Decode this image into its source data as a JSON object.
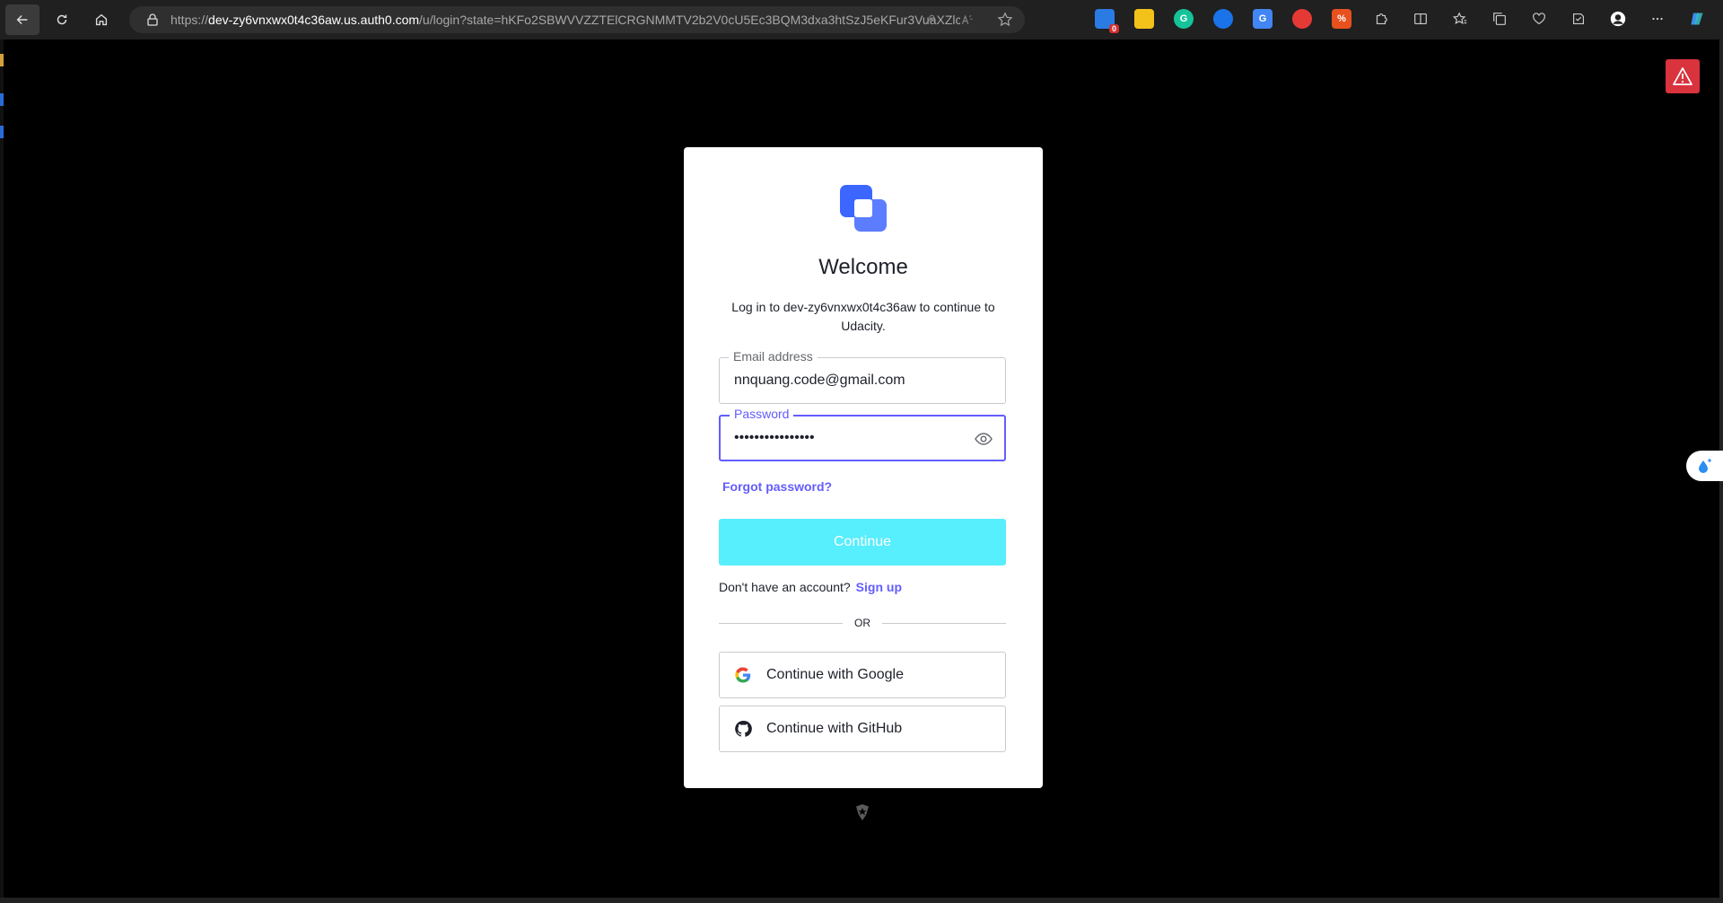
{
  "browser": {
    "url_prefix": "https://",
    "url_host": "dev-zy6vnxwx0t4c36aw.us.auth0.com",
    "url_path": "/u/login?state=hKFo2SBWVVZZTElCRGNMMTV2b2V0cU5Ec3BQM3dxa3htSzJ5eKFur3VuaXZlcnN...",
    "extension_badge": "0",
    "extension_pdf_label": "%"
  },
  "login": {
    "title": "Welcome",
    "subtitle": "Log in to dev-zy6vnxwx0t4c36aw to continue to Udacity.",
    "email_label": "Email address",
    "email_value": "nnquang.code@gmail.com",
    "password_label": "Password",
    "password_value": "••••••••••••••••",
    "forgot_label": "Forgot password?",
    "continue_label": "Continue",
    "no_account_text": "Don't have an account?",
    "signup_label": "Sign up",
    "or_text": "OR",
    "google_label": "Continue with Google",
    "github_label": "Continue with GitHub"
  },
  "colors": {
    "accent": "#635dff",
    "continue_button": "#57eefd",
    "warning": "#d9333d",
    "logo_blue": "#3b66ff"
  }
}
